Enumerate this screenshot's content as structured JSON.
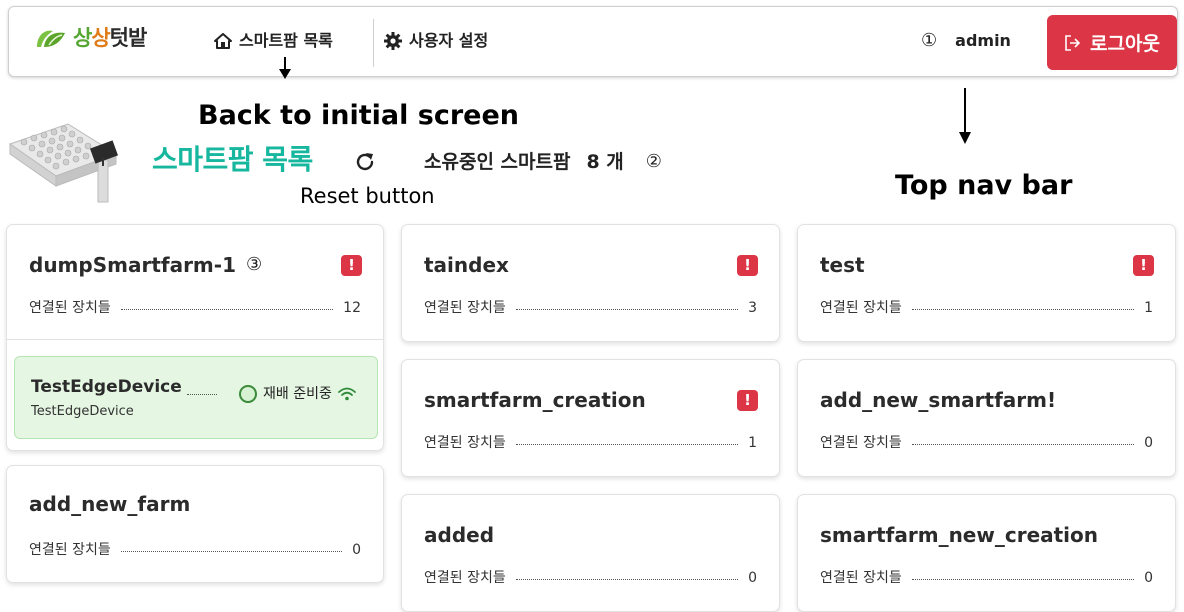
{
  "navbar": {
    "logo_text": [
      "상",
      "상",
      "텃",
      "밭"
    ],
    "home_label": "스마트팜 목록",
    "settings_label": "사용자 설정",
    "marker_1": "①",
    "username": "admin",
    "logout_label": "로그아웃",
    "colors": {
      "logout_bg": "#dc3545",
      "logo_text": [
        "#55a632",
        "#e07b18",
        "#2a2a2a",
        "#2a2a2a"
      ]
    }
  },
  "annotations": {
    "back": "Back to initial screen",
    "topnav": "Top nav bar",
    "reset": "Reset button"
  },
  "header": {
    "title": "스마트팜 목록",
    "owned_label": "소유중인 스마트팜",
    "owned_count": "8 개",
    "marker_2": "②",
    "title_color": "#16b79e"
  },
  "device_label": "연결된 장치들",
  "farms": [
    {
      "name": "dumpSmartfarm-1",
      "marker": "③",
      "devices": "12",
      "alert": "!"
    },
    {
      "name": "add_new_farm",
      "devices": "0"
    },
    {
      "name": "taindex",
      "devices": "3",
      "alert": "!"
    },
    {
      "name": "smartfarm_creation",
      "devices": "1",
      "alert": "!"
    },
    {
      "name": "added",
      "devices": "0"
    },
    {
      "name": "test",
      "devices": "1",
      "alert": "!"
    },
    {
      "name": "add_new_smartfarm!",
      "devices": "0"
    },
    {
      "name": "smartfarm_new_creation",
      "devices": "0"
    }
  ],
  "edge_device": {
    "name": "TestEdgeDevice",
    "id": "TestEdgeDevice",
    "status": "재배 준비중",
    "icons": [
      "status-circle-icon",
      "wifi-icon"
    ]
  }
}
